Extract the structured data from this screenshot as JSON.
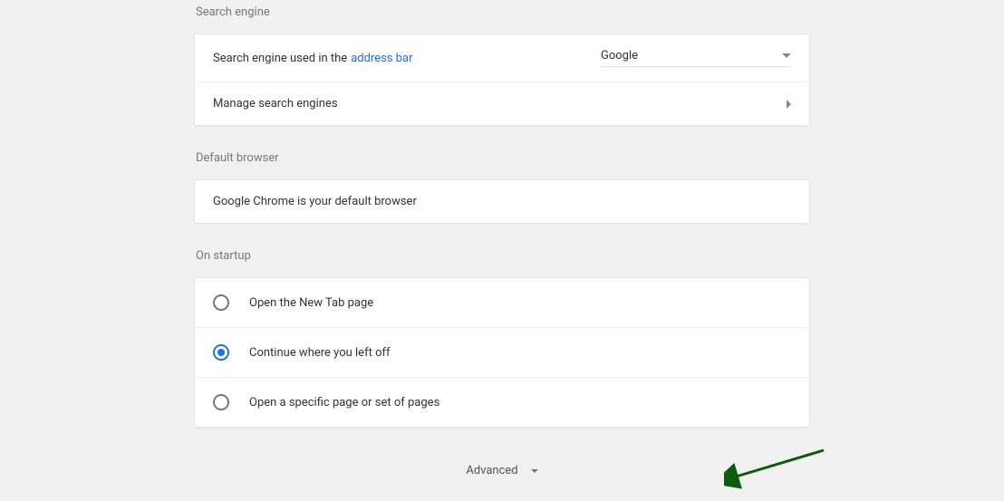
{
  "sections": {
    "search_engine": {
      "title": "Search engine",
      "row1_prefix": "Search engine used in the ",
      "row1_link": "address bar",
      "selected_engine": "Google",
      "row2_label": "Manage search engines"
    },
    "default_browser": {
      "title": "Default browser",
      "status": "Google Chrome is your default browser"
    },
    "on_startup": {
      "title": "On startup",
      "options": [
        "Open the New Tab page",
        "Continue where you left off",
        "Open a specific page or set of pages"
      ],
      "selected_index": 1
    }
  },
  "advanced_label": "Advanced",
  "annotation_arrow_color": "#0b5c0b"
}
